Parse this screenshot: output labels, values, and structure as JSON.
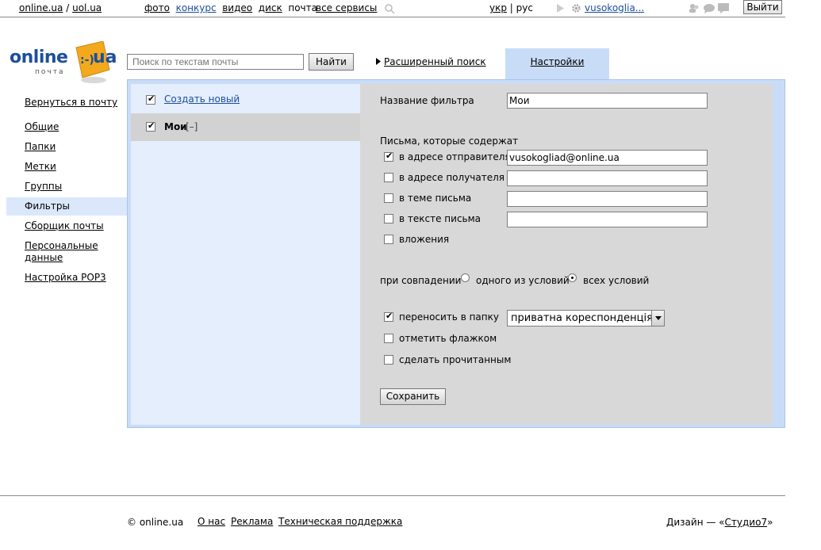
{
  "topbar": {
    "site1": "online.ua",
    "slash": "/",
    "site2": "uol.ua",
    "services": [
      {
        "label": "фото",
        "style": "link"
      },
      {
        "label": "конкурс",
        "style": "blue"
      },
      {
        "label": "видео",
        "style": "link"
      },
      {
        "label": "диск",
        "style": "link"
      },
      {
        "label": "почта",
        "style": "plain"
      }
    ],
    "all_services": "все сервисы",
    "lang_ukr": "укр",
    "lang_sep": "|",
    "lang_rus": "рус",
    "user": "vusokoglia...",
    "logout": "Выйти"
  },
  "logo": {
    "word": "online",
    "ua": "ua",
    "sub": "почта"
  },
  "search": {
    "placeholder": "Поиск по текстам почты",
    "button": "Найти"
  },
  "advanced_search": "Расширенный поиск",
  "settings_tab": "Настройки",
  "nav": {
    "back": "Вернуться в почту",
    "items": [
      {
        "label": "Общие",
        "active": false
      },
      {
        "label": "Папки",
        "active": false
      },
      {
        "label": "Метки",
        "active": false
      },
      {
        "label": "Группы",
        "active": false
      },
      {
        "label": "Фильтры",
        "active": true
      },
      {
        "label": "Сборщик почты",
        "active": false
      },
      {
        "label": "Персональные данные",
        "active": false
      },
      {
        "label": "Настройка POP3",
        "active": false
      }
    ]
  },
  "filters": {
    "create_new": "Создать новый",
    "items": [
      {
        "name": "Мои",
        "toggle": "[–]",
        "checked": true
      }
    ]
  },
  "editor": {
    "name_label": "Название фильтра",
    "name_value": "Мои",
    "contains_heading": "Письма, которые содержат",
    "conditions": [
      {
        "label": "в адресе отправителя",
        "checked": true,
        "value": "vusokogliad@online.ua"
      },
      {
        "label": "в адресе получателя",
        "checked": false,
        "value": ""
      },
      {
        "label": "в теме письма",
        "checked": false,
        "value": ""
      },
      {
        "label": "в тексте письма",
        "checked": false,
        "value": ""
      }
    ],
    "attachments": {
      "label": "вложения",
      "checked": false
    },
    "match_label": "при совпадении",
    "match_any": {
      "label": "одного из условий",
      "checked": false
    },
    "match_all": {
      "label": "всех условий",
      "checked": true
    },
    "actions": [
      {
        "label": "переносить в папку",
        "checked": true
      },
      {
        "label": "отметить флажком",
        "checked": false
      },
      {
        "label": "сделать прочитанным",
        "checked": false
      }
    ],
    "folder_selected": "приватна кореспонденція",
    "save": "Сохранить"
  },
  "footer": {
    "copyright": "© online.ua",
    "about": "О нас",
    "ads": "Реклама",
    "support": "Техническая поддержка",
    "design_prefix": "Дизайн — «",
    "design_link": "Студио7",
    "design_suffix": "»"
  },
  "colors": {
    "brand_blue": "#1d4f9b",
    "tab_bg": "#c9dcf7",
    "editor_bg": "#d8d8d8"
  }
}
